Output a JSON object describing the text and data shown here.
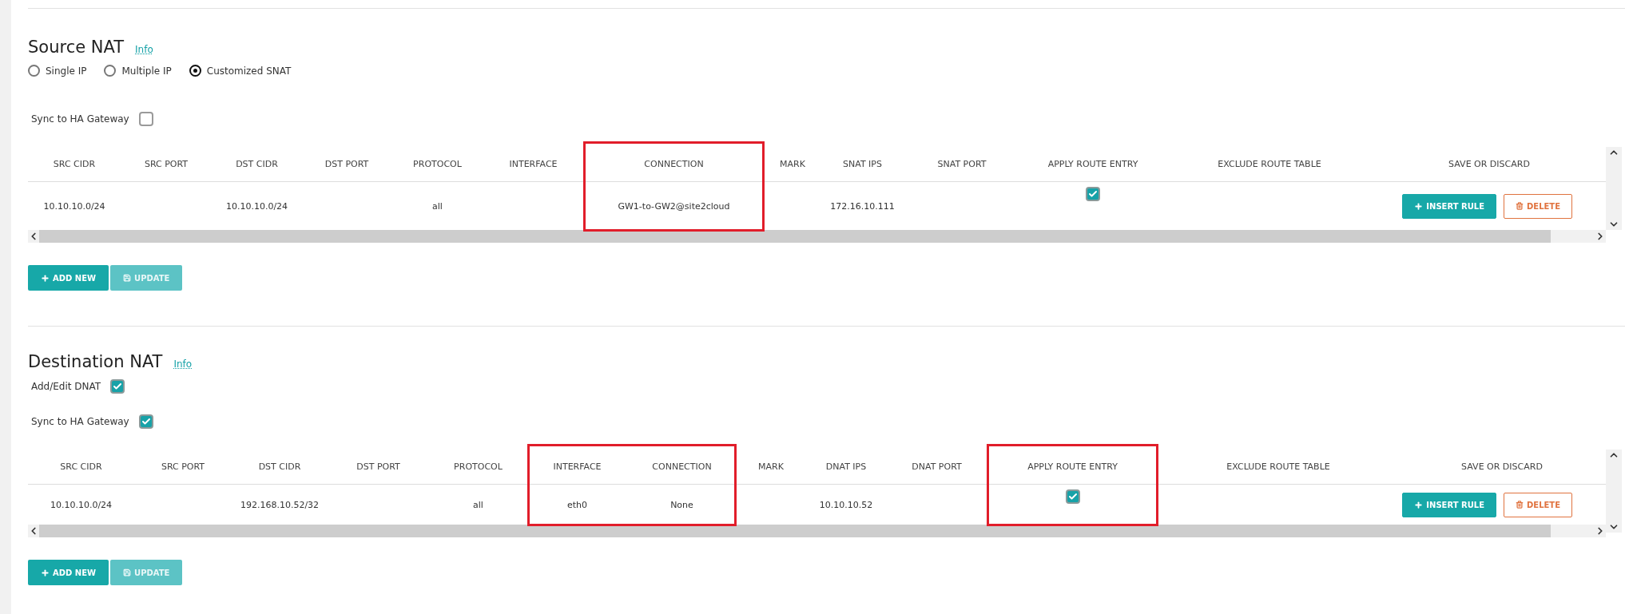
{
  "sections": [
    {
      "title": "Source NAT",
      "info": "Info",
      "radios": [
        {
          "label": "Single IP",
          "selected": false
        },
        {
          "label": "Multiple IP",
          "selected": false
        },
        {
          "label": "Customized SNAT",
          "selected": true
        }
      ],
      "toggles": [
        {
          "label": "Sync to HA Gateway",
          "checked": false
        }
      ],
      "columns": [
        {
          "label": "SRC CIDR",
          "highlighted": false
        },
        {
          "label": "SRC PORT",
          "highlighted": false
        },
        {
          "label": "DST CIDR",
          "highlighted": false
        },
        {
          "label": "DST PORT",
          "highlighted": false
        },
        {
          "label": "PROTOCOL",
          "highlighted": false
        },
        {
          "label": "INTERFACE",
          "highlighted": false
        },
        {
          "label": "CONNECTION",
          "highlighted": true
        },
        {
          "label": "MARK",
          "highlighted": false
        },
        {
          "label": "SNAT IPS",
          "highlighted": false
        },
        {
          "label": "SNAT PORT",
          "highlighted": false
        },
        {
          "label": "APPLY ROUTE ENTRY",
          "highlighted": false
        },
        {
          "label": "EXCLUDE ROUTE TABLE",
          "highlighted": false
        },
        {
          "label": "SAVE OR DISCARD",
          "highlighted": false
        }
      ],
      "rows": [
        {
          "cells": [
            {
              "kind": "text",
              "text": "10.10.10.0/24"
            },
            {
              "kind": "blank"
            },
            {
              "kind": "text",
              "text": "10.10.10.0/24"
            },
            {
              "kind": "blank"
            },
            {
              "kind": "text",
              "text": "all"
            },
            {
              "kind": "blank"
            },
            {
              "kind": "text",
              "text": "GW1-to-GW2@site2cloud"
            },
            {
              "kind": "blank"
            },
            {
              "kind": "text",
              "text": "172.16.10.111"
            },
            {
              "kind": "blank"
            },
            {
              "kind": "checkbox",
              "checked": true
            },
            {
              "kind": "blank"
            },
            {
              "kind": "actions",
              "buttons": [
                {
                  "label": "INSERT RULE",
                  "kind": "insert"
                },
                {
                  "label": "DELETE",
                  "kind": "delete"
                }
              ]
            }
          ]
        }
      ],
      "buttons": [
        {
          "label": "ADD NEW",
          "kind": "add",
          "disabled": false
        },
        {
          "label": "UPDATE",
          "kind": "save",
          "disabled": true
        }
      ]
    },
    {
      "title": "Destination NAT",
      "info": "Info",
      "toggles": [
        {
          "label": "Add/Edit DNAT",
          "checked": true
        },
        {
          "label": "Sync to HA Gateway",
          "checked": true
        }
      ],
      "columns": [
        {
          "label": "SRC CIDR",
          "highlighted": false
        },
        {
          "label": "SRC PORT",
          "highlighted": false
        },
        {
          "label": "DST CIDR",
          "highlighted": false
        },
        {
          "label": "DST PORT",
          "highlighted": false
        },
        {
          "label": "PROTOCOL",
          "highlighted": false
        },
        {
          "label": "INTERFACE",
          "highlighted": true
        },
        {
          "label": "CONNECTION",
          "highlighted": true
        },
        {
          "label": "MARK",
          "highlighted": false
        },
        {
          "label": "DNAT IPS",
          "highlighted": false
        },
        {
          "label": "DNAT PORT",
          "highlighted": false
        },
        {
          "label": "APPLY ROUTE ENTRY",
          "highlighted": true
        },
        {
          "label": "EXCLUDE ROUTE TABLE",
          "highlighted": false
        },
        {
          "label": "SAVE OR DISCARD",
          "highlighted": false
        }
      ],
      "rows": [
        {
          "cells": [
            {
              "kind": "text",
              "text": "10.10.10.0/24"
            },
            {
              "kind": "blank"
            },
            {
              "kind": "text",
              "text": "192.168.10.52/32"
            },
            {
              "kind": "blank"
            },
            {
              "kind": "text",
              "text": "all"
            },
            {
              "kind": "text",
              "text": "eth0"
            },
            {
              "kind": "text",
              "text": "None"
            },
            {
              "kind": "blank"
            },
            {
              "kind": "text",
              "text": "10.10.10.52"
            },
            {
              "kind": "blank"
            },
            {
              "kind": "checkbox",
              "checked": true
            },
            {
              "kind": "blank"
            },
            {
              "kind": "actions",
              "buttons": [
                {
                  "label": "INSERT RULE",
                  "kind": "insert"
                },
                {
                  "label": "DELETE",
                  "kind": "delete"
                }
              ]
            }
          ]
        }
      ],
      "buttons": [
        {
          "label": "ADD NEW",
          "kind": "add",
          "disabled": false
        },
        {
          "label": "UPDATE",
          "kind": "save",
          "disabled": true
        }
      ]
    }
  ]
}
